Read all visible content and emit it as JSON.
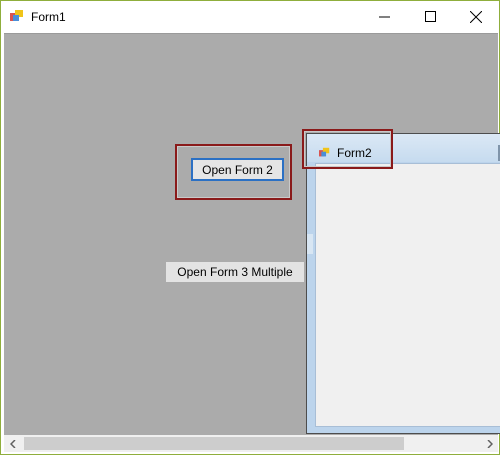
{
  "window": {
    "title": "Form1",
    "icon": "form-app-icon",
    "controls": [
      "minimize-icon",
      "maximize-icon",
      "close-icon"
    ]
  },
  "buttons": {
    "open_form2": "Open Form 2",
    "open_form3": "Open Form 3 Multiple"
  },
  "child_window": {
    "title": "Form2",
    "icon": "form-app-icon"
  },
  "scrollbar": {
    "left_arrow": "chevron-left-icon",
    "right_arrow": "chevron-right-icon"
  },
  "colors": {
    "mdi_background": "#ababab",
    "highlight_border": "#8a1a1a",
    "focus_border": "#2b70c4"
  }
}
